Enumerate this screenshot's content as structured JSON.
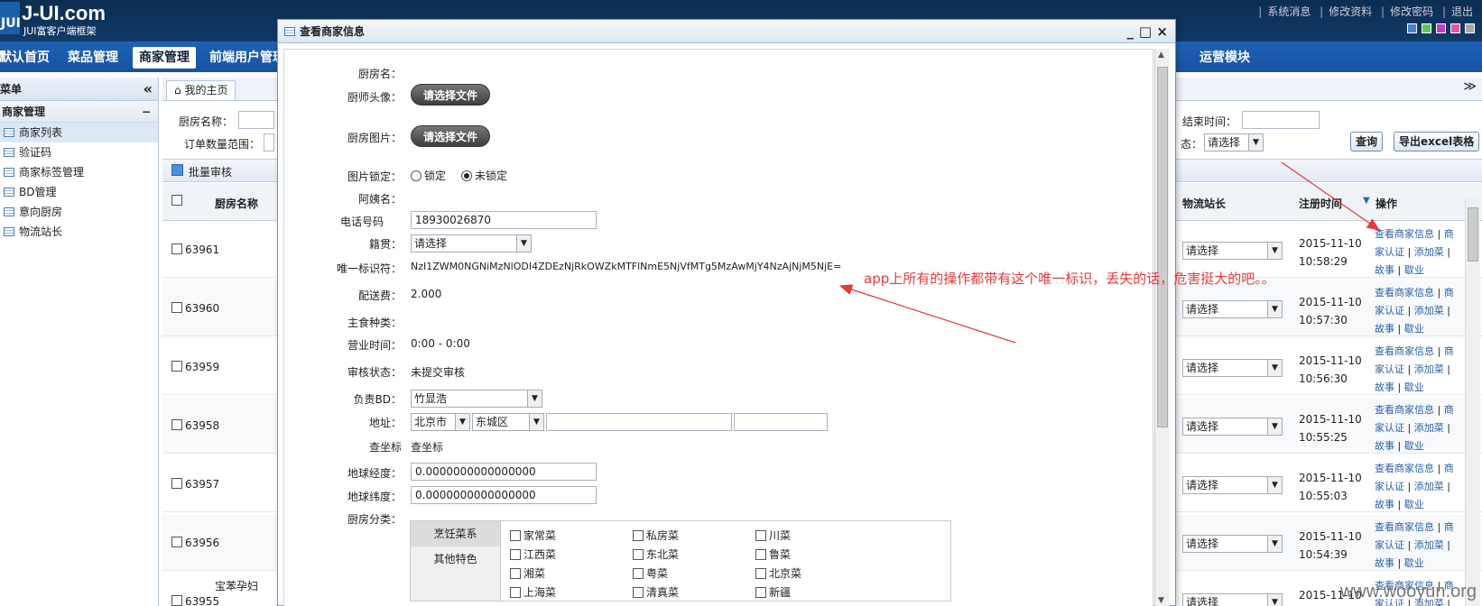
{
  "header": {
    "logo_icon": "JUI",
    "logo_title": "J-UI.com",
    "logo_sub": "JUI富客户端框架",
    "links": [
      "系统消息",
      "修改资料",
      "修改密码",
      "退出"
    ],
    "themes": [
      "#4a7fd0",
      "#5cc65c",
      "#c040c0",
      "#e05a9a",
      "#a8a8a8"
    ]
  },
  "nav": {
    "items": [
      "默认首页",
      "菜品管理",
      "商家管理",
      "前端用户管理",
      "运营模块"
    ],
    "active": "商家管理"
  },
  "sidebar": {
    "title": "菜单",
    "group": "商家管理",
    "items": [
      "商家列表",
      "验证码",
      "商家标签管理",
      "BD管理",
      "意向厨房",
      "物流站长"
    ]
  },
  "tabs": [
    "我的主页"
  ],
  "search": {
    "kitchen_name_label": "厨房名称：",
    "order_range_label": "订单数量范围：",
    "end_time_label": "结束时间：",
    "status_label": "态：",
    "status_value": "请选择",
    "query_button": "查询",
    "export_button": "导出excel表格"
  },
  "toolbar": {
    "batch_label": "批量审核"
  },
  "grid": {
    "headers": [
      "厨房名称",
      "物流站长",
      "注册时间",
      "操作"
    ],
    "rows": [
      {
        "id": "63961",
        "name": "",
        "select": "请选择",
        "date": "2015-11-10",
        "time": "10:58:29"
      },
      {
        "id": "63960",
        "name": "",
        "select": "请选择",
        "date": "2015-11-10",
        "time": "10:57:30"
      },
      {
        "id": "63959",
        "name": "",
        "select": "请选择",
        "date": "2015-11-10",
        "time": "10:56:30"
      },
      {
        "id": "63958",
        "name": "",
        "select": "请选择",
        "date": "2015-11-10",
        "time": "10:55:25"
      },
      {
        "id": "63957",
        "name": "",
        "select": "请选择",
        "date": "2015-11-10",
        "time": "10:55:03"
      },
      {
        "id": "63956",
        "name": "",
        "select": "请选择",
        "date": "2015-11-10",
        "time": "10:54:39"
      },
      {
        "id": "63955",
        "name": "宝苯孕妇",
        "select": "请选择",
        "date": "2015-11-10",
        "time": ""
      }
    ],
    "ops": {
      "view": "查看商家信息",
      "sep": "|",
      "view_tail": "商",
      "cert": "家认证",
      "add": "添加菜",
      "add_sep": "|",
      "story": "故事",
      "suspend": "歇业"
    }
  },
  "dialog": {
    "title": "查看商家信息",
    "controls": [
      "_",
      "□",
      "×"
    ],
    "fields": {
      "kitchen_name": {
        "label": "厨房名：",
        "value": ""
      },
      "chef_avatar": {
        "label": "厨师头像：",
        "button": "请选择文件"
      },
      "kitchen_img": {
        "label": "厨房图片：",
        "button": "请选择文件"
      },
      "img_lock": {
        "label": "图片锁定：",
        "options": [
          "锁定",
          "未锁定"
        ],
        "selected": "未锁定"
      },
      "aunt_name": {
        "label": "阿姨名：",
        "value": ""
      },
      "phone": {
        "label": "电话号码",
        "value": "18930026870"
      },
      "origin": {
        "label": "籍贯：",
        "value": "请选择"
      },
      "uid": {
        "label": "唯一标识符：",
        "value": "NzI1ZWM0NGNiMzNlODI4ZDEzNjRkOWZkMTFlNmE5NjVfMTg5MzAwMjY4NzAjNjM5NjE="
      },
      "delivery_fee": {
        "label": "配送费：",
        "value": "2.000"
      },
      "staple": {
        "label": "主食种类：",
        "value": ""
      },
      "hours": {
        "label": "营业时间：",
        "value": "0:00 - 0:00"
      },
      "audit_status": {
        "label": "审核状态：",
        "value": "未提交审核"
      },
      "bd": {
        "label": "负责BD：",
        "value": "竹显浩"
      },
      "address": {
        "label": "地址：",
        "city": "北京市",
        "district": "东城区",
        "street": "",
        "detail": ""
      },
      "coords": {
        "label": "查坐标",
        "value": "查坐标"
      },
      "lng": {
        "label": "地球经度：",
        "value": "0.0000000000000000"
      },
      "lat": {
        "label": "地球纬度：",
        "value": "0.0000000000000000"
      },
      "category": {
        "label": "厨房分类："
      }
    },
    "category_tabs": [
      "烹饪菜系",
      "其他特色"
    ],
    "cuisines": [
      "家常菜",
      "私房菜",
      "川菜",
      "江西菜",
      "东北菜",
      "鲁菜",
      "湘菜",
      "粤菜",
      "北京菜",
      "上海菜",
      "清真菜",
      "新疆"
    ]
  },
  "annotation": "app上所有的操作都带有这个唯一标识，丢失的话，危害挺大的吧。。",
  "watermark": "www.wooyun.org",
  "accent_colors": {
    "annotation": "#e53a3a",
    "nav": "#1e62b3",
    "header": "#0d2d52"
  }
}
